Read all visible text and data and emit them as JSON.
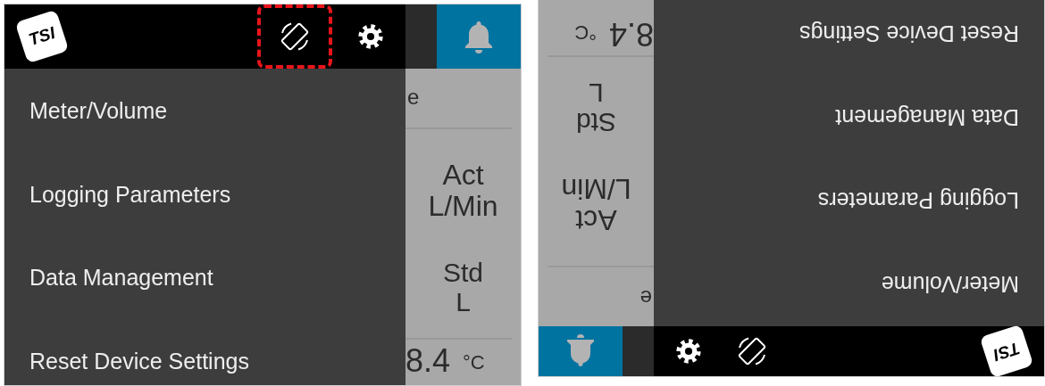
{
  "screens": [
    {
      "rotated": false,
      "logo_text": "TSI",
      "rotate_highlighted": true,
      "menu": [
        {
          "label": "Meter/Volume"
        },
        {
          "label": "Logging Parameters"
        },
        {
          "label": "Data Management"
        },
        {
          "label": "Reset Device Settings"
        }
      ],
      "background": {
        "partial_label": "e",
        "flow_header": [
          "Act",
          "L/Min"
        ],
        "volume_header": [
          "Std",
          "L"
        ],
        "temperature": "8.4",
        "temperature_unit": "°C"
      }
    },
    {
      "rotated": true,
      "logo_text": "TSI",
      "rotate_highlighted": false,
      "menu": [
        {
          "label": "Meter/Volume"
        },
        {
          "label": "Logging Parameters"
        },
        {
          "label": "Data Management"
        },
        {
          "label": "Reset Device Settings"
        }
      ],
      "background": {
        "partial_label": "e",
        "flow_header": [
          "Act",
          "L/Min"
        ],
        "volume_header": [
          "Std",
          "L"
        ],
        "temperature": "8.4",
        "temperature_unit": "°C"
      }
    }
  ]
}
